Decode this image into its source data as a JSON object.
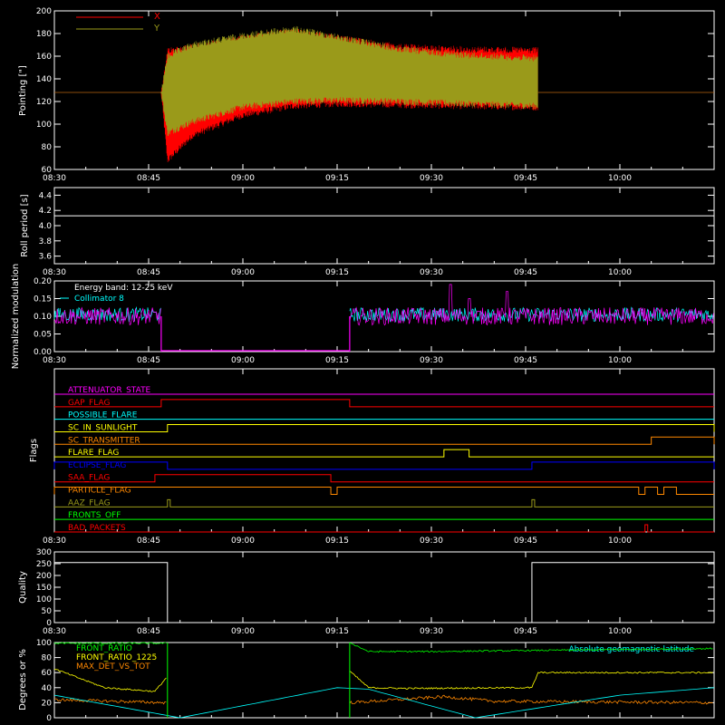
{
  "colors": {
    "background": "#000000",
    "axes": "#ffffff",
    "red": "#ff0000",
    "olive": "#9a9a1a",
    "magenta": "#ff00ff",
    "cyan": "#00ffff",
    "green": "#00ff00",
    "yellow": "#ffff00",
    "orange": "#ff8800",
    "blue": "#0000ff",
    "dark_orange": "#cc6600"
  },
  "chart_data": [
    {
      "type": "line",
      "panel": "pointing",
      "ylabel": "Pointing [\"]",
      "ylim": [
        60,
        200
      ],
      "yticks": [
        60,
        80,
        100,
        120,
        140,
        160,
        180,
        200
      ],
      "xlim": [
        "08:30",
        "10:15"
      ],
      "xticks": [
        "08:30",
        "08:45",
        "09:00",
        "09:15",
        "09:30",
        "09:45",
        "10:00"
      ],
      "legend": "top-left",
      "series": [
        {
          "name": "X",
          "color": "#ff0000",
          "x": [
            "08:30",
            "08:47",
            "08:48",
            "08:52",
            "09:00",
            "09:08",
            "09:15",
            "09:25",
            "09:35",
            "09:47",
            "09:47",
            "10:15"
          ],
          "y_min": [
            128,
            128,
            68,
            90,
            108,
            116,
            118,
            117,
            116,
            115,
            128,
            128
          ],
          "y_max": [
            128,
            128,
            165,
            168,
            176,
            182,
            176,
            168,
            166,
            165,
            128,
            128
          ]
        },
        {
          "name": "Y",
          "color": "#9a9a1a",
          "x": [
            "08:30",
            "08:47",
            "08:48",
            "08:52",
            "09:00",
            "09:08",
            "09:15",
            "09:25",
            "09:35",
            "09:47",
            "09:47",
            "10:15"
          ],
          "y_min": [
            128,
            128,
            92,
            102,
            115,
            120,
            121,
            120,
            118,
            116,
            128,
            128
          ],
          "y_max": [
            128,
            128,
            160,
            170,
            178,
            184,
            177,
            166,
            161,
            158,
            128,
            128
          ]
        }
      ]
    },
    {
      "type": "line",
      "panel": "roll",
      "ylabel": "Roll period [s]",
      "ylim": [
        3.5,
        4.5
      ],
      "yticks": [
        3.6,
        3.8,
        4.0,
        4.2,
        4.4
      ],
      "xticks": [
        "08:30",
        "08:45",
        "09:00",
        "09:15",
        "09:30",
        "09:45",
        "10:00"
      ],
      "series": [
        {
          "name": "",
          "color": "#ffffff",
          "x": [
            "08:30",
            "10:15"
          ],
          "y": [
            4.13,
            4.13
          ]
        }
      ]
    },
    {
      "type": "line",
      "panel": "modulation",
      "ylabel": "Normalized modulation",
      "ylim": [
        0,
        0.2
      ],
      "yticks": [
        0.0,
        0.05,
        0.1,
        0.15,
        0.2
      ],
      "xticks": [
        "08:30",
        "08:45",
        "09:00",
        "09:15",
        "09:30",
        "09:45",
        "10:00"
      ],
      "annotations": [
        "Energy band: 12-25 keV",
        "Collimator 8"
      ],
      "series": [
        {
          "name": "Collimator 8",
          "color": "#00ffff",
          "segments": [
            [
              "08:30",
              "08:47"
            ],
            [
              "09:17",
              "10:15"
            ]
          ],
          "y_mean": 0.105,
          "y_spread": 0.02
        },
        {
          "name": "",
          "color": "#ff00ff",
          "segments": [
            [
              "08:30",
              "08:47"
            ],
            [
              "09:17",
              "10:15"
            ]
          ],
          "y_mean": 0.1,
          "y_spread": 0.025,
          "spikes": [
            [
              "09:33",
              0.19
            ],
            [
              "09:36",
              0.15
            ],
            [
              "09:42",
              0.17
            ]
          ]
        }
      ]
    },
    {
      "type": "table",
      "panel": "flags",
      "ylabel": "Flags",
      "xticks": [
        "08:30",
        "08:45",
        "09:00",
        "09:15",
        "09:30",
        "09:45",
        "10:00"
      ],
      "flags": [
        {
          "name": "ATTENUATOR_STATE",
          "color": "#ff00ff",
          "on": []
        },
        {
          "name": "GAP_FLAG",
          "color": "#ff0000",
          "on": [
            [
              "08:47",
              "09:17"
            ]
          ]
        },
        {
          "name": "POSSIBLE_FLARE",
          "color": "#00ffff",
          "on": []
        },
        {
          "name": "SC_IN_SUNLIGHT",
          "color": "#ffff00",
          "on": [
            [
              "08:48",
              "10:15"
            ]
          ]
        },
        {
          "name": "SC_TRANSMITTER",
          "color": "#ff8800",
          "on": [
            [
              "10:05",
              "10:15"
            ]
          ]
        },
        {
          "name": "FLARE_FLAG",
          "color": "#ffff00",
          "on": [
            [
              "09:32",
              "09:36"
            ]
          ]
        },
        {
          "name": "ECLIPSE_FLAG",
          "color": "#0000ff",
          "on": [
            [
              "08:30",
              "08:48"
            ],
            [
              "09:46",
              "10:15"
            ]
          ]
        },
        {
          "name": "SAA_FLAG",
          "color": "#ff0000",
          "on": [
            [
              "08:46",
              "09:14"
            ]
          ]
        },
        {
          "name": "PARTICLE_FLAG",
          "color": "#ff8800",
          "on": [
            [
              "08:30",
              "09:14"
            ],
            [
              "09:15",
              "10:03"
            ],
            [
              "10:04",
              "10:06"
            ],
            [
              "10:07",
              "10:09"
            ]
          ]
        },
        {
          "name": "AAZ_FLAG",
          "color": "#9a9a1a",
          "on": [
            [
              "08:48",
              "08:48"
            ],
            [
              "09:46",
              "09:46"
            ]
          ]
        },
        {
          "name": "FRONTS_OFF",
          "color": "#00ff00",
          "on": []
        },
        {
          "name": "BAD_PACKETS",
          "color": "#ff0000",
          "on": [
            [
              "10:04",
              "10:04"
            ]
          ]
        }
      ]
    },
    {
      "type": "line",
      "panel": "quality",
      "ylabel": "Quality",
      "ylim": [
        0,
        300
      ],
      "yticks": [
        0,
        50,
        100,
        150,
        200,
        250,
        300
      ],
      "xticks": [
        "08:30",
        "08:45",
        "09:00",
        "09:15",
        "09:30",
        "09:45",
        "10:00"
      ],
      "series": [
        {
          "name": "",
          "color": "#ffffff",
          "x": [
            "08:30",
            "08:48",
            "08:48",
            "09:46",
            "09:46",
            "10:15"
          ],
          "y": [
            255,
            255,
            0,
            0,
            255,
            255
          ]
        }
      ]
    },
    {
      "type": "line",
      "panel": "ratios",
      "ylabel": "Degrees or %",
      "ylim": [
        0,
        100
      ],
      "yticks": [
        0,
        20,
        40,
        60,
        80,
        100
      ],
      "annotations": [
        "Absolute geomagnetic latitude"
      ],
      "series": [
        {
          "name": "FRONT_RATIO",
          "color": "#00ff00",
          "segments": [
            [
              "08:30",
              "08:48"
            ],
            [
              "09:17",
              "10:15"
            ]
          ],
          "x": [
            "08:30",
            "08:48",
            "09:17",
            "09:20",
            "09:30",
            "10:15"
          ],
          "y": [
            99,
            99,
            100,
            88,
            88,
            92
          ]
        },
        {
          "name": "FRONT_RATIO_1225",
          "color": "#ffff00",
          "segments": [
            [
              "08:30",
              "08:48"
            ],
            [
              "09:17",
              "10:15"
            ]
          ],
          "x": [
            "08:30",
            "08:38",
            "08:46",
            "08:48",
            "09:17",
            "09:20",
            "09:26",
            "09:46",
            "09:47",
            "10:15"
          ],
          "y": [
            65,
            40,
            35,
            55,
            62,
            40,
            39,
            40,
            60,
            60
          ]
        },
        {
          "name": "MAX_DET_VS_TOT",
          "color": "#ff8800",
          "segments": [
            [
              "08:30",
              "08:48"
            ],
            [
              "09:17",
              "10:15"
            ]
          ],
          "x": [
            "08:30",
            "08:48",
            "09:17",
            "09:32",
            "09:40",
            "10:15"
          ],
          "y": [
            24,
            20,
            20,
            28,
            22,
            20
          ]
        },
        {
          "name": "Absolute geomagnetic latitude",
          "color": "#00ffff",
          "x": [
            "08:30",
            "08:50",
            "09:15",
            "09:20",
            "09:37",
            "10:00",
            "10:15"
          ],
          "y": [
            30,
            0,
            40,
            38,
            0,
            30,
            40
          ]
        }
      ]
    }
  ]
}
